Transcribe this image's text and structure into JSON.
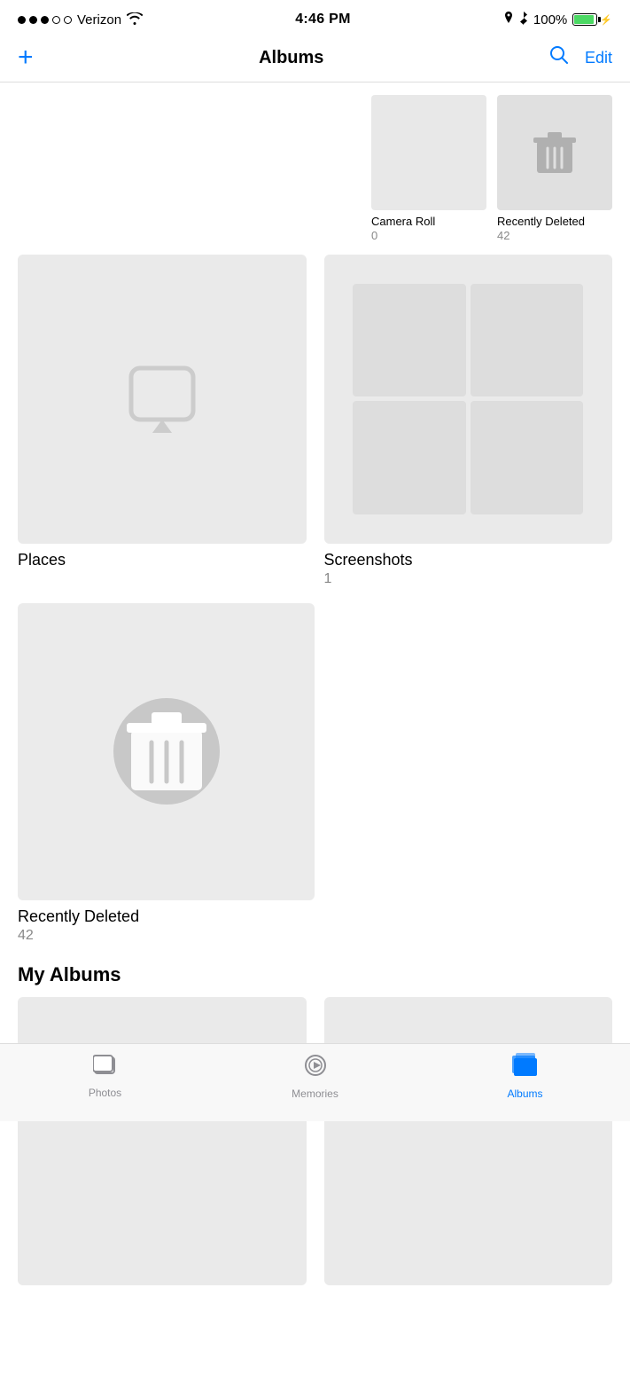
{
  "statusBar": {
    "carrier": "Verizon",
    "time": "4:46 PM",
    "battery": "100%"
  },
  "navBar": {
    "addLabel": "+",
    "title": "Albums",
    "editLabel": "Edit"
  },
  "topAlbums": [
    {
      "name": "Camera Roll",
      "count": "0",
      "hasTrash": false
    },
    {
      "name": "Recently Deleted",
      "count": "42",
      "hasTrash": true
    }
  ],
  "mainAlbums": {
    "places": {
      "name": "Places",
      "count": ""
    },
    "screenshots": {
      "name": "Screenshots",
      "count": "1"
    }
  },
  "recentlyDeleted": {
    "name": "Recently Deleted",
    "count": "42"
  },
  "myAlbums": {
    "sectionLabel": "My Albums"
  },
  "tabBar": {
    "tabs": [
      {
        "label": "Photos",
        "active": false
      },
      {
        "label": "Memories",
        "active": false
      },
      {
        "label": "Albums",
        "active": true
      }
    ]
  }
}
